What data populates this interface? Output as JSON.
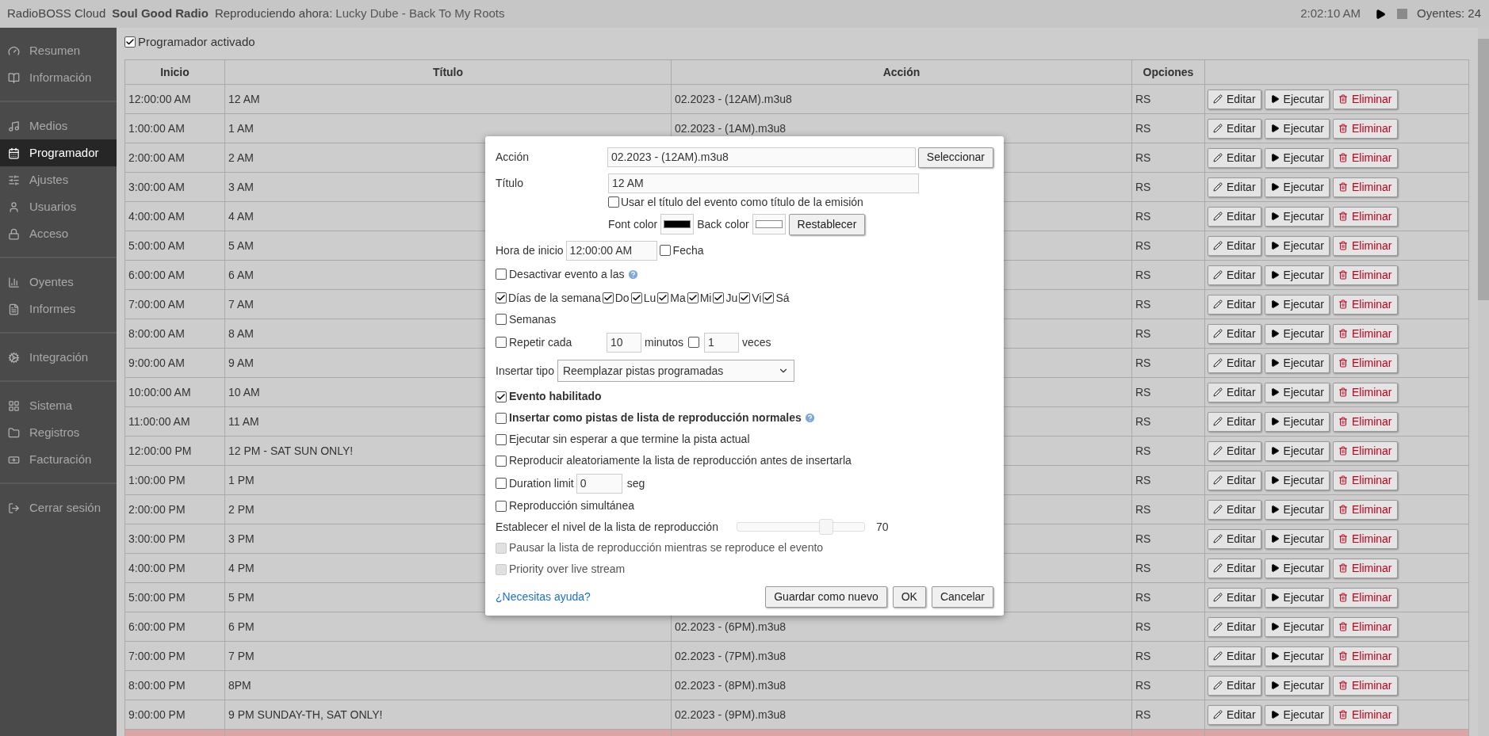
{
  "top_bar": {
    "app": "RadioBOSS Cloud",
    "station": "Soul Good Radio",
    "now_playing_label": "Reproduciendo ahora:",
    "now_playing": "Lucky Dube - Back To My Roots",
    "time": "2:02:10 AM",
    "listeners": "Oyentes: 24"
  },
  "sidebar": {
    "groups": [
      {
        "items": [
          {
            "label": "Resumen",
            "selected": false
          },
          {
            "label": "Información",
            "selected": false
          }
        ]
      },
      {
        "items": [
          {
            "label": "Medios",
            "selected": false
          },
          {
            "label": "Programador",
            "selected": true
          },
          {
            "label": "Ajustes",
            "selected": false
          },
          {
            "label": "Usuarios",
            "selected": false
          },
          {
            "label": "Acceso",
            "selected": false
          }
        ]
      },
      {
        "items": [
          {
            "label": "Oyentes",
            "selected": false
          },
          {
            "label": "Informes",
            "selected": false
          }
        ]
      },
      {
        "items": [
          {
            "label": "Integración",
            "selected": false
          }
        ]
      },
      {
        "items": [
          {
            "label": "Sistema",
            "selected": false
          },
          {
            "label": "Registros",
            "selected": false
          },
          {
            "label": "Facturación",
            "selected": false
          }
        ]
      },
      {
        "items": [
          {
            "label": "Cerrar sesión",
            "selected": false
          }
        ]
      }
    ]
  },
  "scheduler_enabled": {
    "label": "Programador activado",
    "checked": true
  },
  "table": {
    "columns": [
      "Inicio",
      "Título",
      "Acción",
      "Opciones"
    ],
    "rows": [
      {
        "start": "12:00:00 AM",
        "title": "12 AM",
        "action": "02.2023 - (12AM).m3u8",
        "options": "RS",
        "buttons": [
          "Editar",
          "Ejecutar",
          "Eliminar"
        ],
        "highlighted": false
      },
      {
        "start": "1:00:00 AM",
        "title": "1 AM",
        "action": "02.2023 - (1AM).m3u8",
        "options": "RS",
        "buttons": [
          "Editar",
          "Ejecutar",
          "Eliminar"
        ],
        "highlighted": false
      },
      {
        "start": "2:00:00 AM",
        "title": "2 AM",
        "options": "RS",
        "buttons": [
          "Editar",
          "Ejecutar",
          "Eliminar"
        ],
        "highlighted": false
      },
      {
        "start": "3:00:00 AM",
        "title": "3 AM",
        "options": "RS",
        "buttons": [
          "Editar",
          "Ejecutar",
          "Eliminar"
        ],
        "highlighted": false
      },
      {
        "start": "4:00:00 AM",
        "title": "4 AM",
        "options": "RS",
        "buttons": [
          "Editar",
          "Ejecutar",
          "Eliminar"
        ],
        "highlighted": false
      },
      {
        "start": "5:00:00 AM",
        "title": "5 AM",
        "options": "RS",
        "buttons": [
          "Editar",
          "Ejecutar",
          "Eliminar"
        ],
        "highlighted": false
      },
      {
        "start": "6:00:00 AM",
        "title": "6 AM",
        "options": "RS",
        "buttons": [
          "Editar",
          "Ejecutar",
          "Eliminar"
        ],
        "highlighted": false
      },
      {
        "start": "7:00:00 AM",
        "title": "7 AM",
        "options": "RS",
        "buttons": [
          "Editar",
          "Ejecutar",
          "Eliminar"
        ],
        "highlighted": false
      },
      {
        "start": "8:00:00 AM",
        "title": "8 AM",
        "options": "RS",
        "buttons": [
          "Editar",
          "Ejecutar",
          "Eliminar"
        ],
        "highlighted": false
      },
      {
        "start": "9:00:00 AM",
        "title": "9 AM",
        "options": "RS",
        "buttons": [
          "Editar",
          "Ejecutar",
          "Eliminar"
        ],
        "highlighted": false
      },
      {
        "start": "10:00:00 AM",
        "title": "10 AM",
        "options": "RS",
        "buttons": [
          "Editar",
          "Ejecutar",
          "Eliminar"
        ],
        "highlighted": false
      },
      {
        "start": "11:00:00 AM",
        "title": "11 AM",
        "options": "RS",
        "buttons": [
          "Editar",
          "Ejecutar",
          "Eliminar"
        ],
        "highlighted": false
      },
      {
        "start": "12:00:00 PM",
        "title": "12 PM - SAT SUN ONLY!",
        "options": "RS",
        "buttons": [
          "Editar",
          "Ejecutar",
          "Eliminar"
        ],
        "highlighted": false
      },
      {
        "start": "1:00:00 PM",
        "title": "1 PM",
        "options": "RS",
        "buttons": [
          "Editar",
          "Ejecutar",
          "Eliminar"
        ],
        "highlighted": false
      },
      {
        "start": "2:00:00 PM",
        "title": "2 PM",
        "options": "RS",
        "buttons": [
          "Editar",
          "Ejecutar",
          "Eliminar"
        ],
        "highlighted": false
      },
      {
        "start": "3:00:00 PM",
        "title": "3 PM",
        "options": "RS",
        "buttons": [
          "Editar",
          "Ejecutar",
          "Eliminar"
        ],
        "highlighted": false
      },
      {
        "start": "4:00:00 PM",
        "title": "4 PM",
        "options": "RS",
        "buttons": [
          "Editar",
          "Ejecutar",
          "Eliminar"
        ],
        "highlighted": false
      },
      {
        "start": "5:00:00 PM",
        "title": "5 PM",
        "options": "RS",
        "buttons": [
          "Editar",
          "Ejecutar",
          "Eliminar"
        ],
        "highlighted": false
      },
      {
        "start": "6:00:00 PM",
        "title": "6 PM",
        "action": "02.2023 - (6PM).m3u8",
        "options": "RS",
        "buttons": [
          "Editar",
          "Ejecutar",
          "Eliminar"
        ],
        "highlighted": false
      },
      {
        "start": "7:00:00 PM",
        "title": "7 PM",
        "action": "02.2023 - (7PM).m3u8",
        "options": "RS",
        "buttons": [
          "Editar",
          "Ejecutar",
          "Eliminar"
        ],
        "highlighted": false
      },
      {
        "start": "8:00:00 PM",
        "title": "8PM",
        "action": "02.2023 - (8PM).m3u8",
        "options": "RS",
        "buttons": [
          "Editar",
          "Ejecutar",
          "Eliminar"
        ],
        "highlighted": false
      },
      {
        "start": "9:00:00 PM",
        "title": "9 PM SUNDAY-TH, SAT ONLY!",
        "action": "02.2023 - (9PM).m3u8",
        "options": "RS",
        "buttons": [
          "Editar",
          "Ejecutar",
          "Eliminar"
        ],
        "highlighted": false
      },
      {
        "highlighted": true
      }
    ]
  },
  "dialog": {
    "action": {
      "label": "Acción",
      "value": "02.2023 - (12AM).m3u8",
      "button": "Seleccionar"
    },
    "title": {
      "label": "Título",
      "value": "12 AM"
    },
    "use_title": {
      "label": "Usar el título del evento como título de la emisión",
      "checked": false
    },
    "font_color": {
      "label": "Font color",
      "color": "#000000"
    },
    "back_color": {
      "label": "Back color",
      "color": "#ffffff"
    },
    "reset_button": "Restablecer",
    "start_time": {
      "label": "Hora de inicio",
      "value": "12:00:00 AM"
    },
    "date": {
      "label": "Fecha",
      "checked": false
    },
    "disable_event": {
      "label": "Desactivar evento a las",
      "checked": false
    },
    "weekdays": {
      "label": "Días de la semana",
      "checked": true,
      "days": [
        {
          "label": "Do",
          "checked": true
        },
        {
          "label": "Lu",
          "checked": true
        },
        {
          "label": "Ma",
          "checked": true
        },
        {
          "label": "Mi",
          "checked": true
        },
        {
          "label": "Ju",
          "checked": true
        },
        {
          "label": "Vi",
          "checked": true
        },
        {
          "label": "Sá",
          "checked": true
        }
      ]
    },
    "weeks": {
      "label": "Semanas",
      "checked": false
    },
    "repeat": {
      "label": "Repetir cada",
      "checked": false,
      "minutes_value": "10",
      "minutes_label": "minutos",
      "times_checked": false,
      "times_value": "1",
      "times_label": "veces"
    },
    "insert_type": {
      "label": "Insertar tipo",
      "value": "Reemplazar pistas programadas"
    },
    "rows": [
      {
        "kind": "checkbox",
        "label": "Evento habilitado",
        "checked": true,
        "bold": true,
        "disabled": false,
        "help": false
      },
      {
        "kind": "checkbox",
        "label": "Insertar como pistas de lista de reproducción normales",
        "checked": false,
        "bold": true,
        "disabled": false,
        "help": true
      },
      {
        "kind": "checkbox",
        "label": "Ejecutar sin esperar a que termine la pista actual",
        "checked": false,
        "bold": false,
        "disabled": false,
        "help": false
      },
      {
        "kind": "checkbox",
        "label": "Reproducir aleatoriamente la lista de reproducción antes de insertarla",
        "checked": false,
        "bold": false,
        "disabled": false,
        "help": false
      },
      {
        "kind": "duration",
        "label": "Duration limit",
        "checked": false,
        "value": "0",
        "unit": "seg"
      },
      {
        "kind": "checkbox",
        "label": "Reproducción simultánea",
        "checked": false,
        "bold": false,
        "disabled": false,
        "help": false
      },
      {
        "kind": "slider",
        "label": "Establecer el nivel de la lista de reproducción",
        "level": 0.7,
        "reading": "70"
      },
      {
        "kind": "checkbox",
        "label": "Pausar la lista de reproducción mientras se reproduce el evento",
        "checked": false,
        "bold": false,
        "disabled": true,
        "help": false
      },
      {
        "kind": "checkbox",
        "label": "Priority over live stream",
        "checked": false,
        "bold": false,
        "disabled": true,
        "help": false
      }
    ],
    "help_link": "¿Necesitas ayuda?",
    "buttons": [
      "Guardar como nuevo",
      "OK",
      "Cancelar"
    ]
  }
}
